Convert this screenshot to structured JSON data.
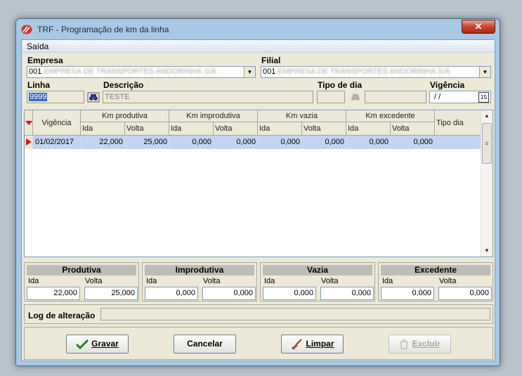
{
  "window": {
    "title": "TRF - Programação de km da linha",
    "close_glyph": "✕"
  },
  "menu": {
    "saida": "Saída"
  },
  "empresa": {
    "label": "Empresa",
    "code": "001",
    "name_blurred": "EMPRESA DE TRANSPORTES ANDORINHA S/A"
  },
  "filial": {
    "label": "Filial",
    "code": "001",
    "name_blurred": "EMPRESA DE TRANSPORTES ANDORINHA S/A"
  },
  "linha": {
    "label": "Linha",
    "value": "9999"
  },
  "descricao": {
    "label": "Descrição",
    "value": "TESTE"
  },
  "tipo_dia": {
    "label": "Tipo de dia",
    "value": ""
  },
  "vigencia": {
    "label": "Vigência",
    "value": " / /",
    "calendar_glyph": "15"
  },
  "grid": {
    "headers": {
      "vigencia": "Vigência",
      "km_produtiva": "Km produtiva",
      "km_improdutiva": "Km improdutiva",
      "km_vazia": "Km vazia",
      "km_excedente": "Km excedente",
      "tipo_dia": "Tipo dia",
      "ida": "Ida",
      "volta": "Volta"
    },
    "rows": [
      {
        "vigencia": "01/02/2017",
        "prod_ida": "22,000",
        "prod_volta": "25,000",
        "improd_ida": "0,000",
        "improd_volta": "0,000",
        "vazia_ida": "0,000",
        "vazia_volta": "0,000",
        "exced_ida": "0,000",
        "exced_volta": "0,000",
        "tipo_dia": ""
      }
    ]
  },
  "totals": {
    "ida_label": "Ida",
    "volta_label": "Volta",
    "produtiva": {
      "title": "Produtiva",
      "ida": "22,000",
      "volta": "25,000"
    },
    "improdutiva": {
      "title": "Improdutiva",
      "ida": "0,000",
      "volta": "0,000"
    },
    "vazia": {
      "title": "Vazia",
      "ida": "0,000",
      "volta": "0,000"
    },
    "excedente": {
      "title": "Excedente",
      "ida": "0,000",
      "volta": "0,000"
    }
  },
  "log": {
    "label": "Log de alteração",
    "value": ""
  },
  "buttons": {
    "gravar": "Gravar",
    "cancelar": "Cancelar",
    "limpar": "Limpar",
    "excluir": "Excluir"
  },
  "colors": {
    "selected_row": "#c2d4ef",
    "titlebar": "#a8c8e4",
    "close": "#c8442d",
    "row_indicator": "#e01010"
  }
}
